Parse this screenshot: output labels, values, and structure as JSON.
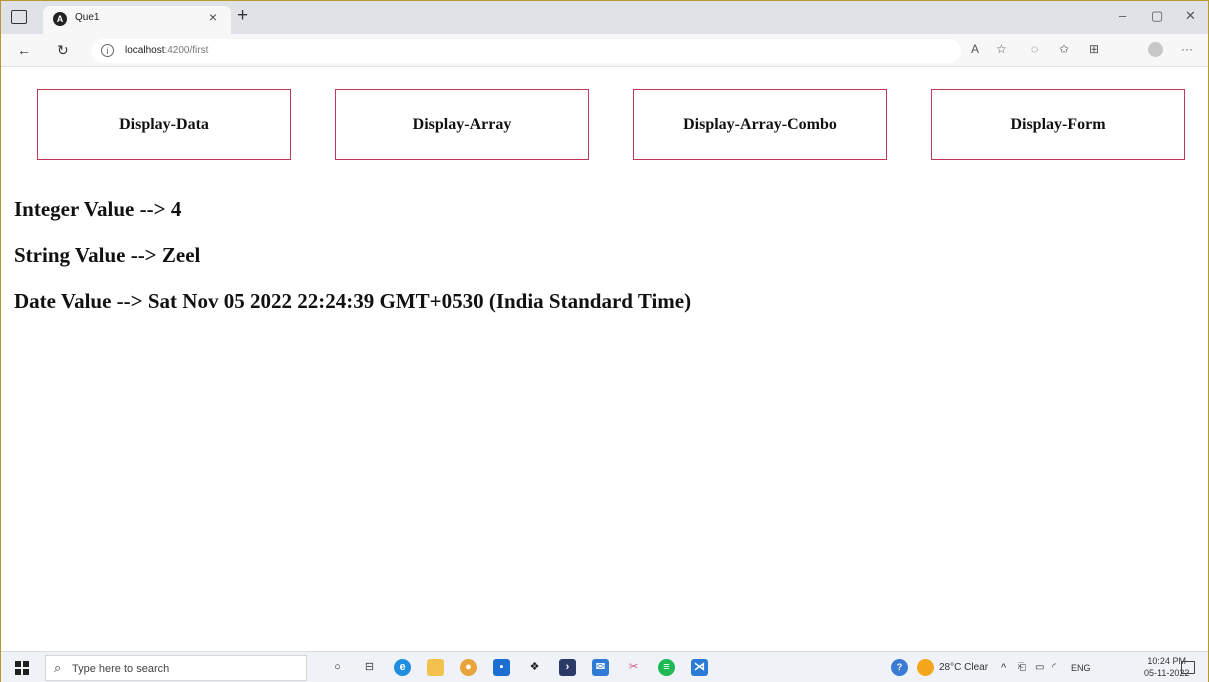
{
  "browser": {
    "tab_title": "Que1",
    "tab_favicon": "angular-logo-icon",
    "url_host": "localhost",
    "url_path": ":4200/first",
    "close_glyph": "×",
    "new_tab_glyph": "+",
    "minimize_glyph": "–",
    "restore_glyph": "▢",
    "close_window_glyph": "✕",
    "more_glyph": "···"
  },
  "nav": {
    "buttons": [
      "Display-Data",
      "Display-Array",
      "Display-Array-Combo",
      "Display-Form"
    ],
    "border_color": "#c0375a"
  },
  "content": {
    "integer_line": "Integer Value --> 4",
    "string_line": "String Value --> Zeel",
    "date_line": "Date Value --> Sat Nov 05 2022 22:24:39 GMT+0530 (India Standard Time)"
  },
  "taskbar": {
    "search_placeholder": "Type here to search",
    "weather": "28°C Clear",
    "language": "ENG",
    "time": "10:24 PM",
    "date": "05-11-2022"
  }
}
